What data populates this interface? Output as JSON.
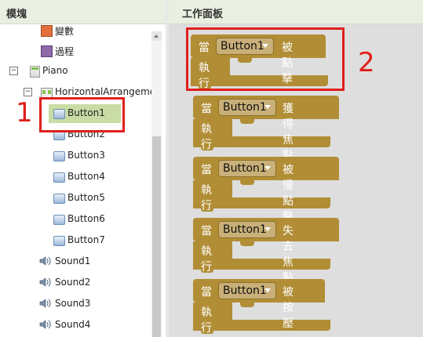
{
  "left_panel": {
    "title": "模塊",
    "items": [
      {
        "label": "變數",
        "color": "#e26f3c"
      },
      {
        "label": "過程",
        "color": "#8f69a8"
      },
      {
        "label": "Piano"
      },
      {
        "label": "HorizontalArrangemer"
      },
      {
        "label": "Button1"
      },
      {
        "label": "Button2"
      },
      {
        "label": "Button3"
      },
      {
        "label": "Button4"
      },
      {
        "label": "Button5"
      },
      {
        "label": "Button6"
      },
      {
        "label": "Button7"
      },
      {
        "label": "Sound1"
      },
      {
        "label": "Sound2"
      },
      {
        "label": "Sound3"
      },
      {
        "label": "Sound4"
      }
    ]
  },
  "workspace": {
    "title": "工作面板",
    "blocks": [
      {
        "prefix": "當",
        "component": "Button1",
        "event": "被點擊",
        "do_label": "執行"
      },
      {
        "prefix": "當",
        "component": "Button1",
        "event": "獲得焦點",
        "do_label": "執行"
      },
      {
        "prefix": "當",
        "component": "Button1",
        "event": "被慢點擊",
        "do_label": "執行"
      },
      {
        "prefix": "當",
        "component": "Button1",
        "event": "失去焦點",
        "do_label": "執行"
      },
      {
        "prefix": "當",
        "component": "Button1",
        "event": "被按壓",
        "do_label": "執行"
      }
    ]
  },
  "annotations": {
    "marker_left": "1",
    "marker_right": "2",
    "color": "#e0201c"
  },
  "colors": {
    "block": "#b18e35",
    "selection": "#c9dca5",
    "header": "#e9efe1"
  }
}
